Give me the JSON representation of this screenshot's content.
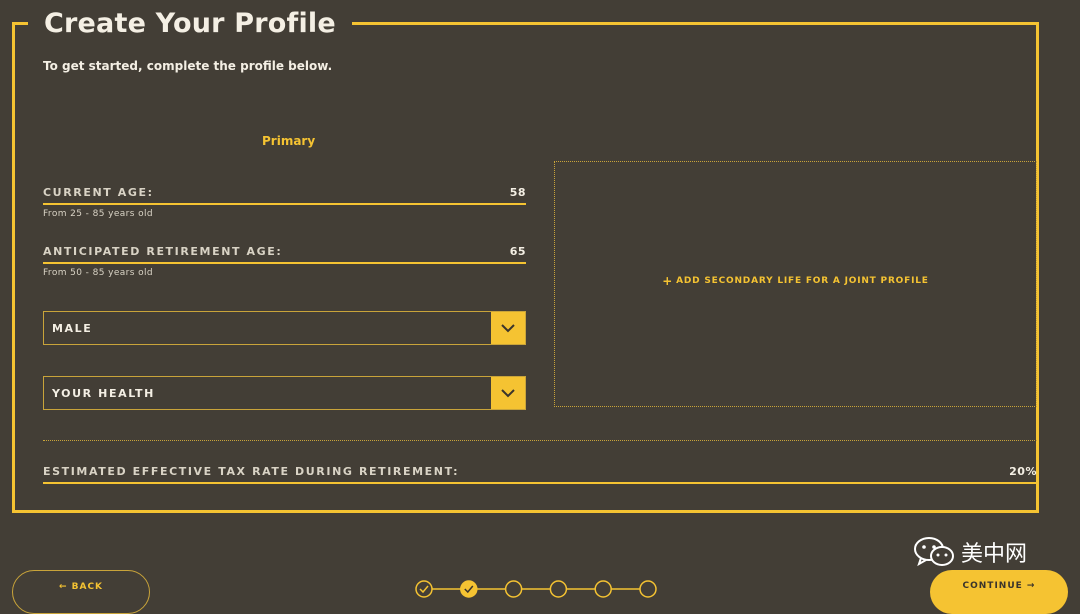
{
  "header": {
    "title": "Create Your Profile",
    "subtitle": "To get started, complete the profile below."
  },
  "primary": {
    "label": "Primary",
    "current_age": {
      "label": "CURRENT AGE:",
      "value": "58",
      "hint": "From 25 - 85 years old"
    },
    "retirement_age": {
      "label": "ANTICIPATED RETIREMENT AGE:",
      "value": "65",
      "hint": "From 50 - 85 years old"
    },
    "gender_select": {
      "value": "MALE"
    },
    "health_select": {
      "value": "YOUR HEALTH"
    }
  },
  "secondary": {
    "add_label": "ADD SECONDARY LIFE FOR A JOINT PROFILE",
    "add_glyph": "+"
  },
  "tax": {
    "label": "ESTIMATED EFFECTIVE TAX RATE DURING RETIREMENT:",
    "value": "20%"
  },
  "nav": {
    "back_label": "← BACK",
    "continue_label": "CONTINUE →"
  },
  "stepper": {
    "total_steps": 6,
    "completed_steps": 2,
    "current_step": 2
  },
  "watermark": {
    "text": "美中网",
    "icon": "wechat-icon"
  },
  "colors": {
    "background": "#433e36",
    "accent": "#f5c332",
    "text": "#f4efe4"
  }
}
